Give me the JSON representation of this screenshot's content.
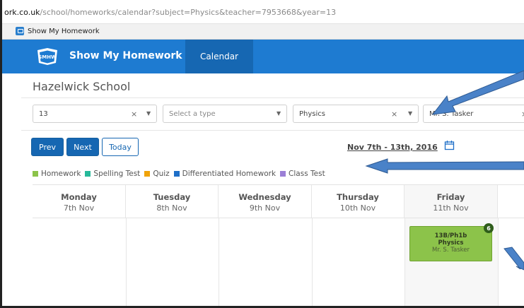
{
  "browser": {
    "url_host": "ork.co.uk",
    "url_path": "/school/homeworks/calendar?subject=Physics&teacher=7953668&year=13",
    "tab_title": "Show My Homework"
  },
  "header": {
    "brand": "Show My Homework",
    "logo_text": "SMHW",
    "nav_tab": "Calendar"
  },
  "school_name": "Hazelwick School",
  "filters": {
    "year": {
      "value": "13",
      "clear": "×",
      "caret": "▼"
    },
    "type": {
      "placeholder": "Select a type",
      "caret": "▼"
    },
    "subject": {
      "value": "Physics",
      "clear": "×",
      "caret": "▼"
    },
    "teacher": {
      "value": "Mr. S. Tasker",
      "clear": "×"
    }
  },
  "controls": {
    "prev": "Prev",
    "next": "Next",
    "today": "Today",
    "date_range": "Nov 7th - 13th, 2016"
  },
  "legend": [
    {
      "label": "Homework",
      "color": "#8cc34a"
    },
    {
      "label": "Spelling Test",
      "color": "#26b99a"
    },
    {
      "label": "Quiz",
      "color": "#f0a30a"
    },
    {
      "label": "Differentiated Homework",
      "color": "#1e6fc8"
    },
    {
      "label": "Class Test",
      "color": "#9b7fd6"
    }
  ],
  "days": [
    {
      "day": "Monday",
      "date": "7th Nov"
    },
    {
      "day": "Tuesday",
      "date": "8th Nov"
    },
    {
      "day": "Wednesday",
      "date": "9th Nov"
    },
    {
      "day": "Thursday",
      "date": "10th Nov"
    },
    {
      "day": "Friday",
      "date": "11th Nov"
    }
  ],
  "event": {
    "class_code": "13B/Ph1b",
    "subject": "Physics",
    "teacher": "Mr. S. Tasker",
    "badge": "6",
    "color": "#8cc34a"
  },
  "colors": {
    "header_blue": "#1e7bd1",
    "nav_active": "#1667b2",
    "annotation_arrow": "#4a82c8"
  }
}
